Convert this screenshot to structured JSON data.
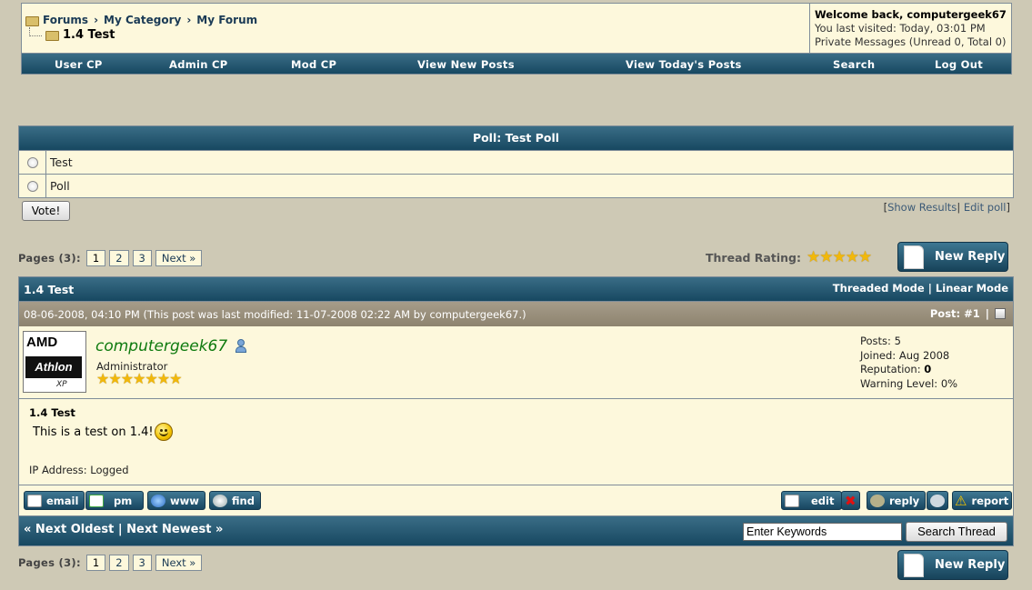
{
  "breadcrumb": {
    "items": [
      "Forums",
      "My Category",
      "My Forum"
    ],
    "current": "1.4 Test"
  },
  "welcome": {
    "line1": "Welcome back, computergeek67",
    "line2": "You last visited: Today, 03:01 PM",
    "line3": "Private Messages (Unread 0, Total 0)"
  },
  "nav": {
    "user_cp": "User CP",
    "admin_cp": "Admin CP",
    "mod_cp": "Mod CP",
    "new_posts": "View New Posts",
    "todays_posts": "View Today's Posts",
    "search": "Search",
    "logout": "Log Out"
  },
  "poll": {
    "title": "Poll: Test Poll",
    "options": [
      "Test",
      "Poll"
    ],
    "vote_label": "Vote!",
    "show_results": "Show Results",
    "edit_poll": "Edit poll",
    "links_open": "[",
    "links_mid": "| ",
    "links_close": "]"
  },
  "pagination": {
    "label": "Pages (3):",
    "pages": [
      "1",
      "2",
      "3"
    ],
    "next": "Next »",
    "current": "1"
  },
  "rating": {
    "label": "Thread Rating:",
    "stars_display": "★★★★★",
    "value": 5
  },
  "new_reply_label": "New Reply",
  "thread": {
    "title": "1.4 Test",
    "threaded_mode": "Threaded Mode",
    "linear_mode": "Linear Mode",
    "mode_sep": "|"
  },
  "post": {
    "datetime": "08-06-2008, 04:10 PM (This post was last modified: 11-07-2008 02:22 AM by computergeek67.)",
    "post_num_label": "Post: #1",
    "post_num_sep": "|",
    "author": {
      "name": "computergeek67",
      "role": "Administrator",
      "stars": "★★★★★★★",
      "avatar_text_1": "AMD",
      "avatar_text_2": "Athlon",
      "avatar_text_3": "XP"
    },
    "stats": {
      "posts_label": "Posts:",
      "posts": "5",
      "joined_label": "Joined:",
      "joined": "Aug 2008",
      "reputation_label": "Reputation:",
      "reputation": "0",
      "warning_label": "Warning Level:",
      "warning": "0%"
    },
    "subject": "1.4 Test",
    "message": "This is a test on 1.4!",
    "ip": "IP Address: Logged",
    "buttons_left": [
      "email",
      "pm",
      "www",
      "find"
    ],
    "buttons_right": [
      "edit",
      "reply",
      "report"
    ]
  },
  "thread_nav": {
    "prev": "« Next Oldest",
    "sep": "|",
    "next": "Next Newest »"
  },
  "search": {
    "value": "Enter Keywords",
    "button": "Search Thread"
  },
  "colors": {
    "background": "#cec9b5",
    "panel": "#fdf8dc",
    "header_blue": "#174861",
    "username_green": "#0e7a0e"
  }
}
